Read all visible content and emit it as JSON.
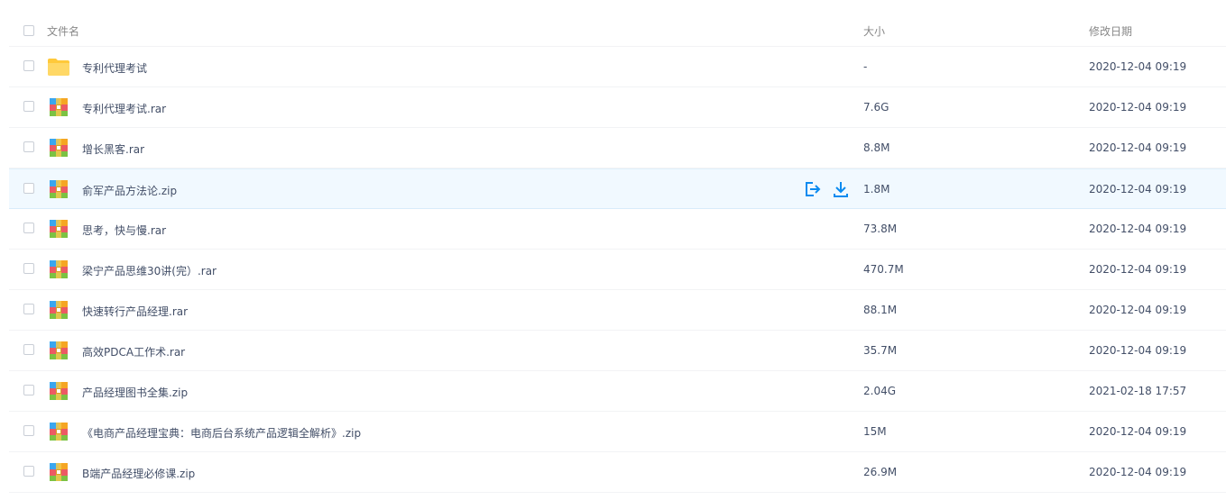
{
  "header": {
    "name_label": "文件名",
    "size_label": "大小",
    "date_label": "修改日期"
  },
  "files": [
    {
      "name": "专利代理考试",
      "size": "-",
      "date": "2020-12-04 09:19",
      "icon": "folder-icon"
    },
    {
      "name": "专利代理考试.rar",
      "size": "7.6G",
      "date": "2020-12-04 09:19",
      "icon": "archive-icon"
    },
    {
      "name": "增长黑客.rar",
      "size": "8.8M",
      "date": "2020-12-04 09:19",
      "icon": "archive-icon"
    },
    {
      "name": "俞军产品方法论.zip",
      "size": "1.8M",
      "date": "2020-12-04 09:19",
      "icon": "archive-icon"
    },
    {
      "name": "思考，快与慢.rar",
      "size": "73.8M",
      "date": "2020-12-04 09:19",
      "icon": "archive-icon"
    },
    {
      "name": "梁宁产品思维30讲(完）.rar",
      "size": "470.7M",
      "date": "2020-12-04 09:19",
      "icon": "archive-icon"
    },
    {
      "name": "快速转行产品经理.rar",
      "size": "88.1M",
      "date": "2020-12-04 09:19",
      "icon": "archive-icon"
    },
    {
      "name": "高效PDCA工作术.rar",
      "size": "35.7M",
      "date": "2020-12-04 09:19",
      "icon": "archive-icon"
    },
    {
      "name": "产品经理图书全集.zip",
      "size": "2.04G",
      "date": "2021-02-18 17:57",
      "icon": "archive-icon"
    },
    {
      "name": "《电商产品经理宝典：电商后台系统产品逻辑全解析》.zip",
      "size": "15M",
      "date": "2020-12-04 09:19",
      "icon": "archive-icon"
    },
    {
      "name": "B端产品经理必修课.zip",
      "size": "26.9M",
      "date": "2020-12-04 09:19",
      "icon": "archive-icon"
    }
  ],
  "hovered_row": 3,
  "hover_actions": [
    "share-icon",
    "download-icon"
  ],
  "colors": {
    "accent": "#0b8bf0",
    "folder": "#ffd35a",
    "hover_bg": "#f1f9ff",
    "text": "#424e67"
  }
}
